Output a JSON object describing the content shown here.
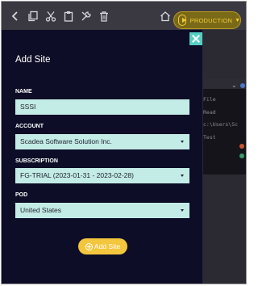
{
  "toolbar": {
    "icons": [
      "back-icon",
      "copy-icon",
      "cut-icon",
      "paste-icon",
      "tools-icon",
      "trash-icon",
      "home-icon"
    ],
    "environment_label": "PRODUCTION"
  },
  "background_panel": {
    "lines": [
      "File",
      "Read",
      "c:\\Users\\Sc",
      "Test"
    ],
    "status_colors": [
      "#4a79c9",
      "#c9562f",
      "#3a9b6a"
    ]
  },
  "modal": {
    "title": "Add Site",
    "fields": {
      "name": {
        "label": "NAME",
        "value": "SSSI"
      },
      "account": {
        "label": "ACCOUNT",
        "value": "Scadea Software Solution Inc."
      },
      "subscription": {
        "label": "SUBSCRIPTION",
        "value": "FG-TRIAL (2023-01-31 - 2023-02-28)"
      },
      "pod": {
        "label": "POD",
        "value": "United States"
      }
    },
    "submit_label": "Add Site"
  },
  "colors": {
    "accent": "#56cfc2",
    "field_bg": "#c3ece6",
    "button": "#f4c63d",
    "modal_bg": "#0d0d27"
  }
}
